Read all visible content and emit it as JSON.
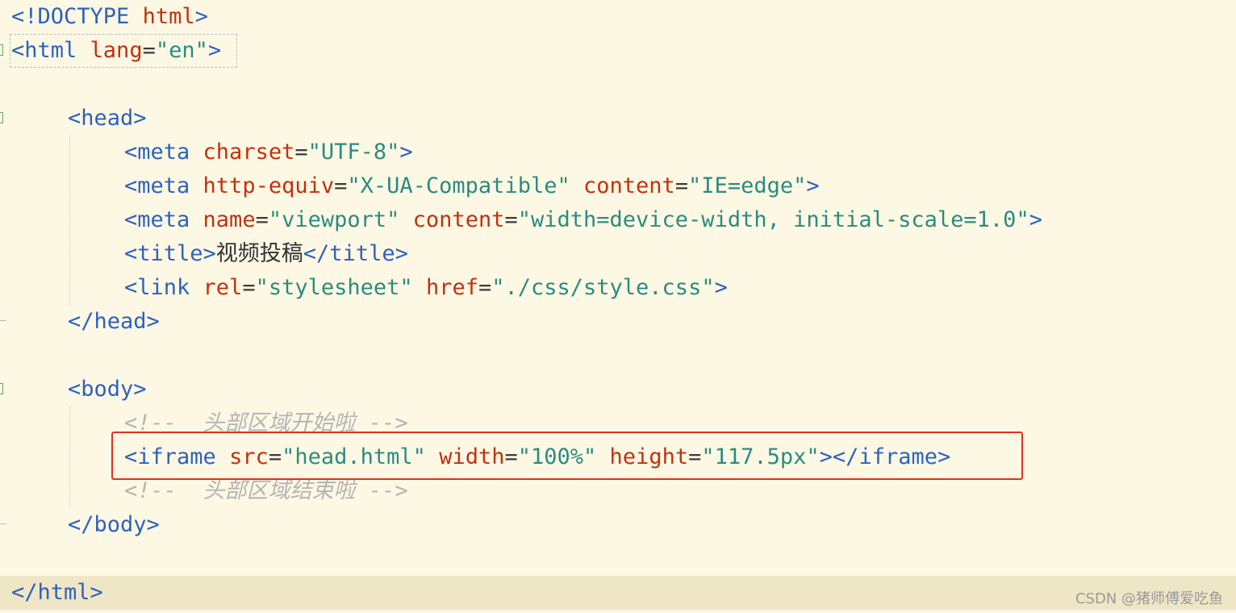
{
  "editor": {
    "lines": {
      "l1": {
        "open": "<!DOCTYPE",
        "name": "html",
        "close": ">"
      },
      "l2": {
        "open": "<html",
        "attr": "lang",
        "eq": "=",
        "val": "\"en\"",
        "close": ">"
      },
      "l4": {
        "tag": "<head>"
      },
      "l5": {
        "open": "<meta",
        "attr": "charset",
        "eq": "=",
        "val": "\"UTF-8\"",
        "close": ">"
      },
      "l6": {
        "open": "<meta",
        "attr1": "http-equiv",
        "eq1": "=",
        "val1": "\"X-UA-Compatible\"",
        "attr2": "content",
        "eq2": "=",
        "val2": "\"IE=edge\"",
        "close": ">"
      },
      "l7": {
        "open": "<meta",
        "attr1": "name",
        "eq1": "=",
        "val1": "\"viewport\"",
        "attr2": "content",
        "eq2": "=",
        "val2": "\"width=device-width, initial-scale=1.0\"",
        "close": ">"
      },
      "l8": {
        "open": "<title>",
        "text": "视频投稿",
        "close": "</title>"
      },
      "l9": {
        "open": "<link",
        "attr1": "rel",
        "eq1": "=",
        "val1": "\"stylesheet\"",
        "attr2": "href",
        "eq2": "=",
        "val2": "\"./css/style.css\"",
        "close": ">"
      },
      "l10": {
        "tag": "</head>"
      },
      "l12": {
        "tag": "<body>"
      },
      "l13": {
        "open": "<!--",
        "text": "头部区域开始啦",
        "close": "-->"
      },
      "l14": {
        "open": "<iframe",
        "attr1": "src",
        "eq1": "=",
        "val1": "\"head.html\"",
        "attr2": "width",
        "eq2": "=",
        "val2": "\"100%\"",
        "attr3": "height",
        "eq3": "=",
        "val3": "\"117.5px\"",
        "close": "></iframe>"
      },
      "l15": {
        "open": "<!--",
        "text": "头部区域结束啦",
        "close": "-->"
      },
      "l16": {
        "tag": "</body>"
      },
      "l18": {
        "tag": "</html>"
      }
    },
    "colors": {
      "background": "#fdf8e4",
      "current_line": "#efe6c6",
      "tag": "#2e62bd",
      "attribute": "#c0320f",
      "string": "#2a8c80",
      "comment": "#b4b4b4",
      "highlight_box": "#e0301e"
    }
  },
  "watermark": "CSDN @猪师傅爱吃鱼"
}
